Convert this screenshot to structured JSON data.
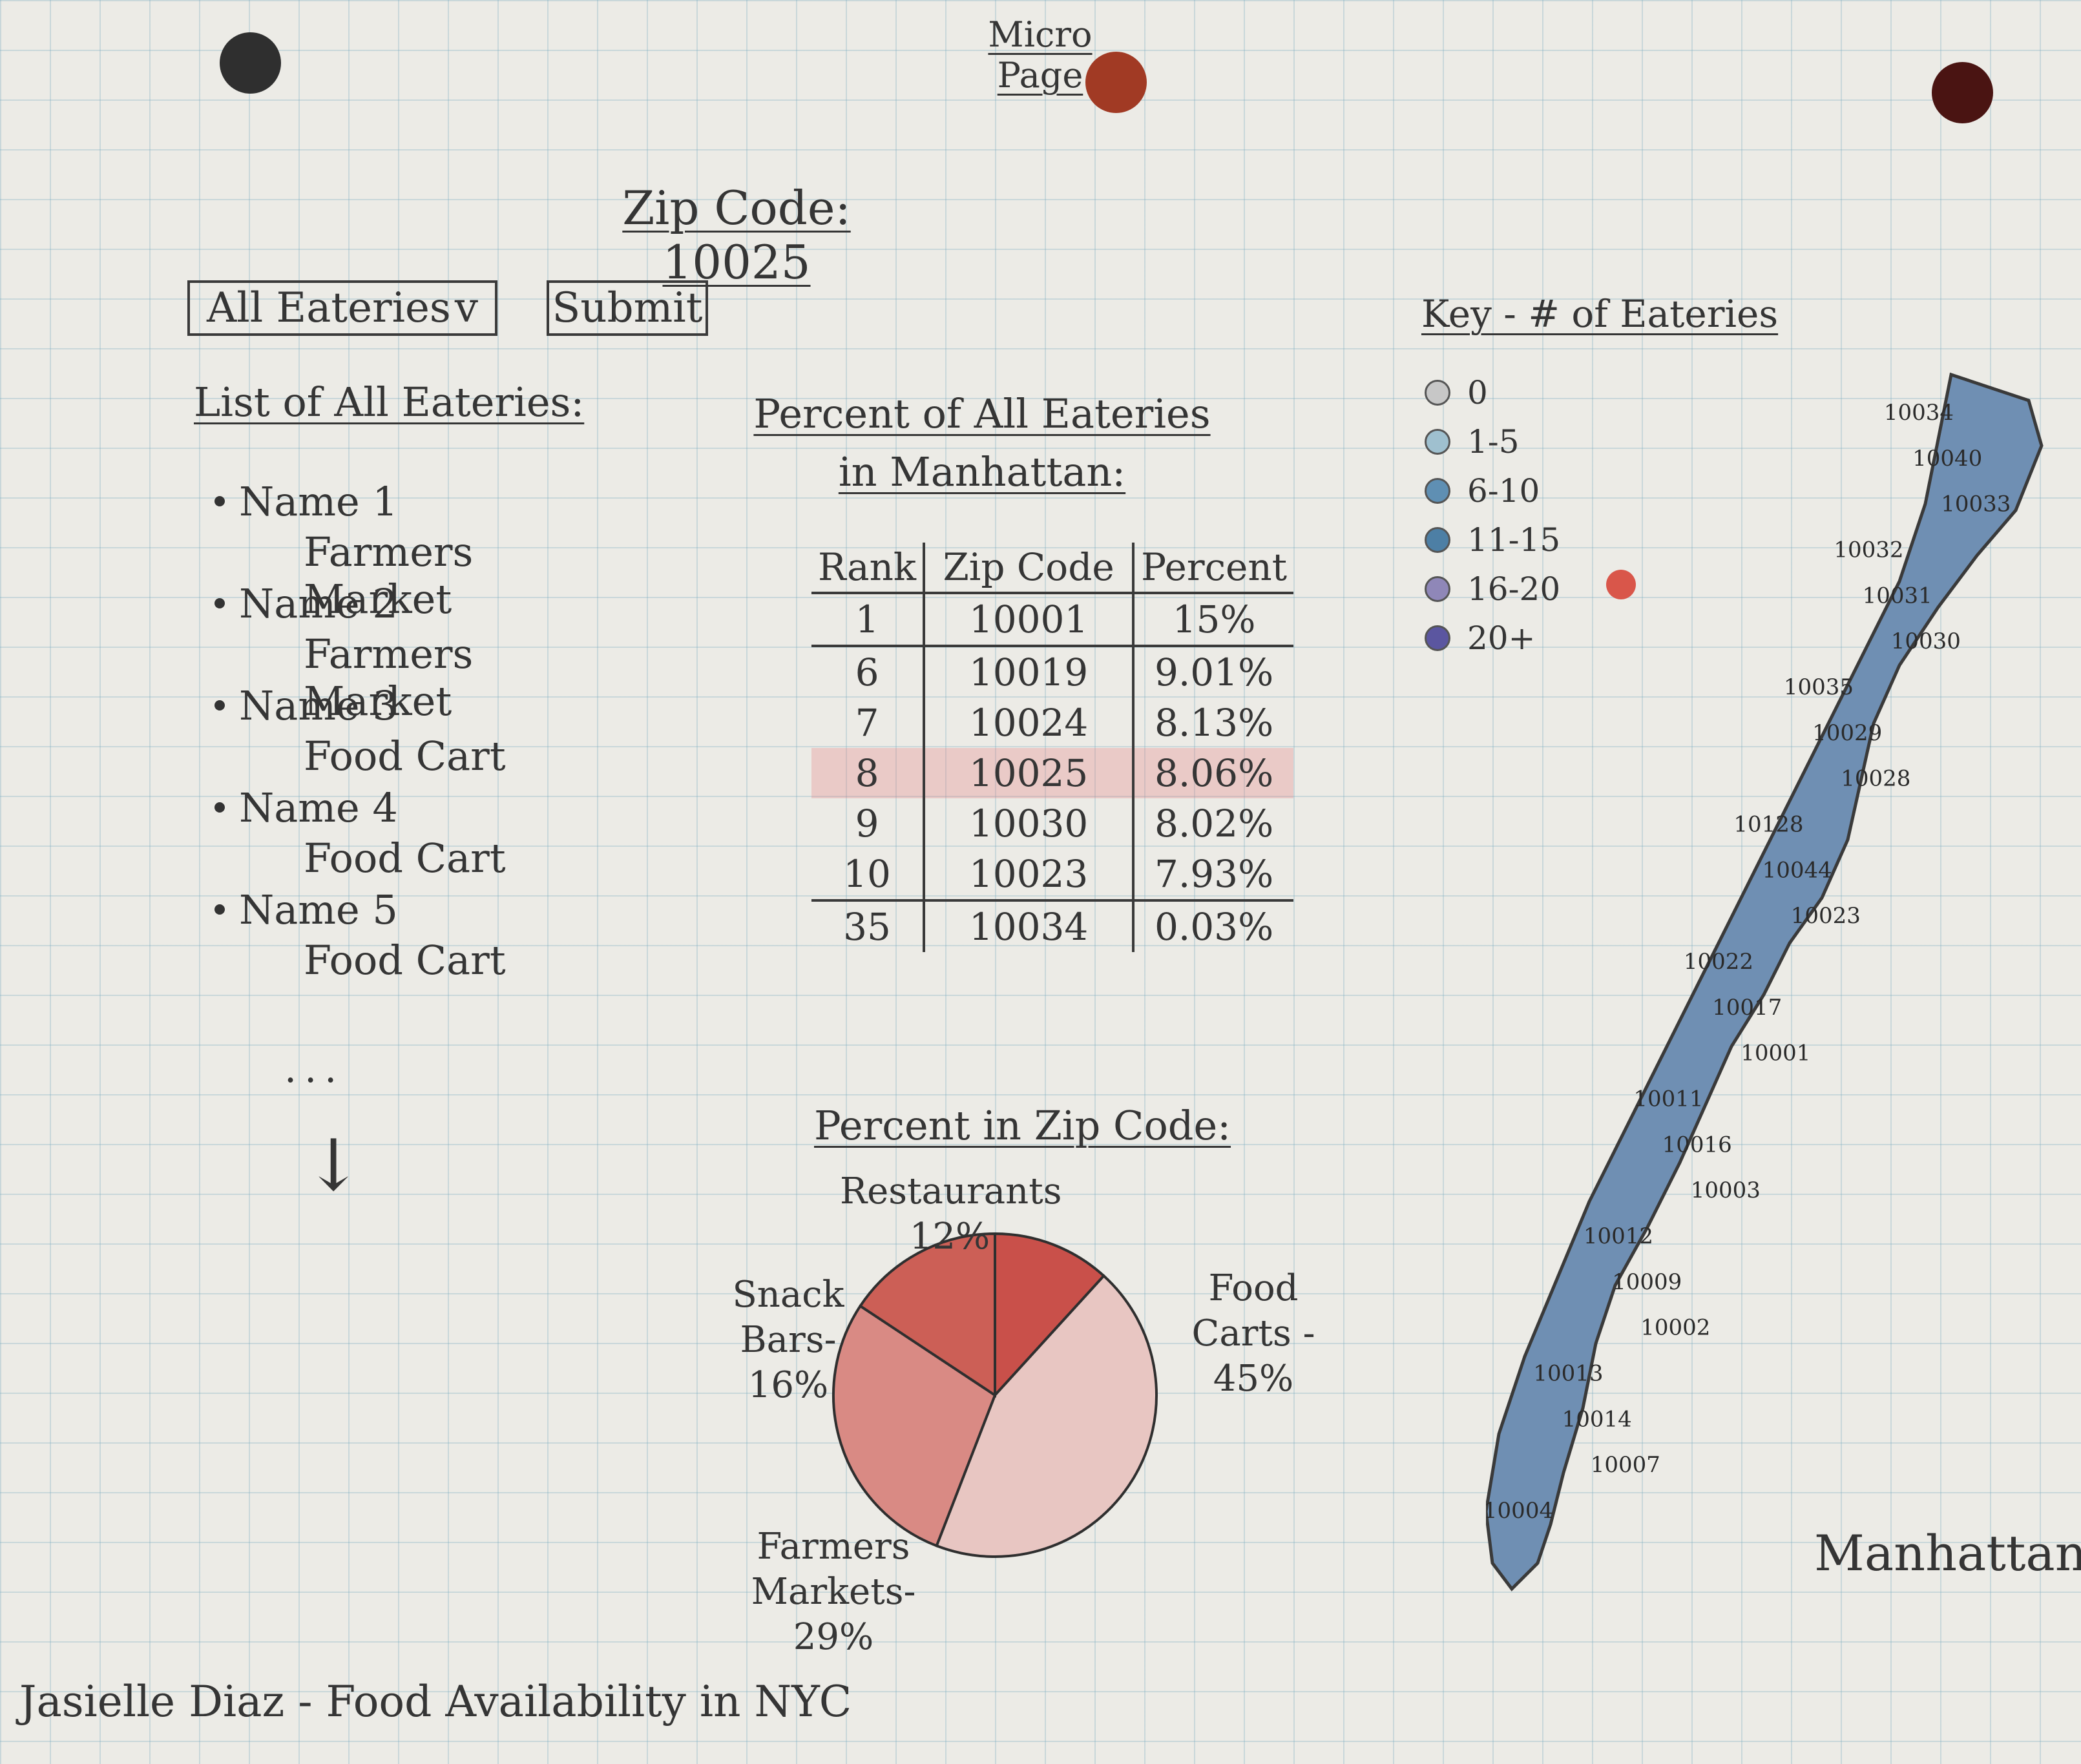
{
  "page_title": "Micro Page",
  "zip_heading": "Zip Code: 10025",
  "controls": {
    "select_value": "All Eateries",
    "select_chevron": "v",
    "submit_label": "Submit"
  },
  "list": {
    "heading": "List of All Eateries:",
    "items": [
      {
        "name": "Name 1",
        "type": "Farmers Market"
      },
      {
        "name": "Name 2",
        "type": "Farmers Market"
      },
      {
        "name": "Name 3",
        "type": "Food Cart"
      },
      {
        "name": "Name 4",
        "type": "Food Cart"
      },
      {
        "name": "Name 5",
        "type": "Food Cart"
      }
    ],
    "more": "...",
    "arrow": "↓"
  },
  "table": {
    "heading_line1": "Percent of All Eateries",
    "heading_line2": "in Manhattan:",
    "columns": [
      "Rank",
      "Zip Code",
      "Percent"
    ],
    "rows": [
      [
        "1",
        "10001",
        "15%"
      ],
      [
        "6",
        "10019",
        "9.01%"
      ],
      [
        "7",
        "10024",
        "8.13%"
      ],
      [
        "8",
        "10025",
        "8.06%"
      ],
      [
        "9",
        "10030",
        "8.02%"
      ],
      [
        "10",
        "10023",
        "7.93%"
      ],
      [
        "35",
        "10034",
        "0.03%"
      ]
    ],
    "highlight_zip": "10025"
  },
  "chart_data": {
    "type": "pie",
    "title": "Percent in Zip Code:",
    "labels": [
      "Restaurants 12%",
      "Food Carts - 45%",
      "Farmers Markets-29%",
      "Snack Bars-16%"
    ],
    "categories": [
      "Restaurants",
      "Food Carts",
      "Farmers Markets",
      "Snack Bars"
    ],
    "values": [
      12,
      45,
      29,
      16
    ],
    "colors": [
      "#c9504a",
      "#e8c6c2",
      "#d98a84",
      "#cc5f56"
    ]
  },
  "key": {
    "heading": "Key - # of Eateries",
    "items": [
      {
        "label": "0",
        "color": "#c7c7c7"
      },
      {
        "label": "1-5",
        "color": "#9fc0cf"
      },
      {
        "label": "6-10",
        "color": "#5f8fb3"
      },
      {
        "label": "11-15",
        "color": "#4d7fa5"
      },
      {
        "label": "16-20",
        "color": "#8f87b8"
      },
      {
        "label": "20+",
        "color": "#5b56a0"
      }
    ],
    "extra_dot_color": "#d9564a"
  },
  "map": {
    "label": "Manhattan",
    "zips": [
      "10034",
      "10040",
      "10033",
      "10032",
      "10031",
      "10030",
      "10035",
      "10029",
      "10028",
      "10128",
      "10044",
      "10023",
      "10022",
      "10017",
      "10001",
      "10011",
      "10016",
      "10003",
      "10012",
      "10009",
      "10002",
      "10013",
      "10014",
      "10007",
      "10004"
    ]
  },
  "footer": "Jasielle Diaz - Food Availability in NYC"
}
